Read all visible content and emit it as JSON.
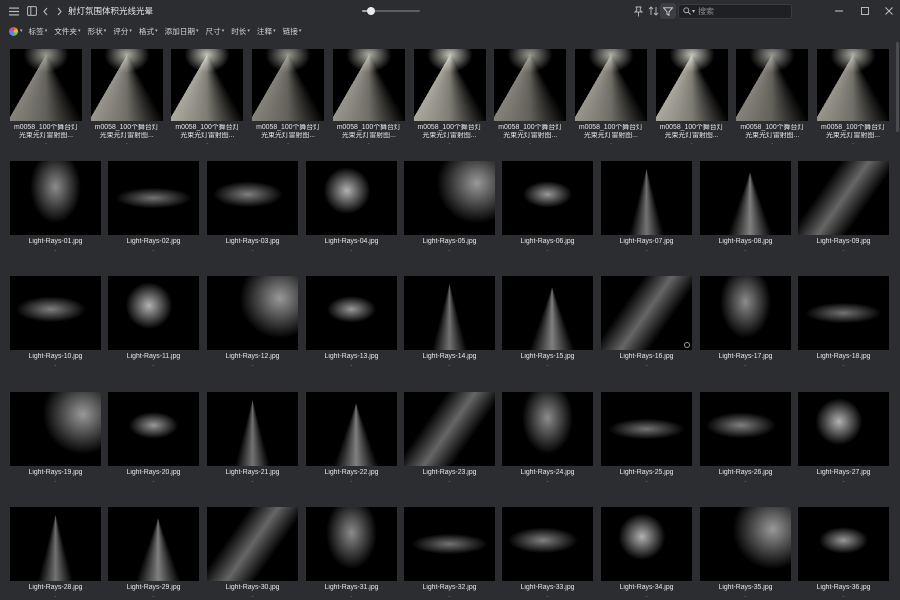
{
  "titlebar": {
    "title": "射灯氛围体积光线光晕",
    "zoom_value": 0.15,
    "search_placeholder": "搜索"
  },
  "filterbar": {
    "items": [
      "标签",
      "文件夹",
      "形状",
      "评分",
      "格式",
      "添加日期",
      "尺寸",
      "时长",
      "注释",
      "链接"
    ]
  },
  "icons": {
    "menu": "hamburger-icon",
    "sidebar": "sidebar-toggle-icon",
    "back": "chevron-left-icon",
    "forward": "chevron-right-icon",
    "pin": "pin-icon",
    "sort": "sort-icon",
    "filter": "filter-icon",
    "search": "search-icon",
    "minimize": "minimize-icon",
    "maximize": "maximize-icon",
    "close": "close-icon",
    "color": "color-wheel-icon"
  },
  "row0_files": [
    {
      "name1": "m0058_100个舞台灯",
      "name2": "光束光灯雷射图...",
      "sub": "-"
    },
    {
      "name1": "m0058_100个舞台灯",
      "name2": "光束光灯雷射图...",
      "sub": "-"
    },
    {
      "name1": "m0058_100个舞台灯",
      "name2": "光束光灯雷射图...",
      "sub": "-"
    },
    {
      "name1": "m0058_100个舞台灯",
      "name2": "光束光灯雷射图...",
      "sub": "-"
    },
    {
      "name1": "m0058_100个舞台灯",
      "name2": "光束光灯雷射图...",
      "sub": "-"
    },
    {
      "name1": "m0058_100个舞台灯",
      "name2": "光束光灯雷射图...",
      "sub": "-"
    },
    {
      "name1": "m0058_100个舞台灯",
      "name2": "光束光灯雷射图...",
      "sub": "-"
    },
    {
      "name1": "m0058_100个舞台灯",
      "name2": "光束光灯雷射图...",
      "sub": "-"
    },
    {
      "name1": "m0058_100个舞台灯",
      "name2": "光束光灯雷射图...",
      "sub": "-"
    },
    {
      "name1": "m0058_100个舞台灯",
      "name2": "光束光灯雷射图...",
      "sub": "-"
    },
    {
      "name1": "m0058_100个舞台灯",
      "name2": "光束光灯雷射图...",
      "sub": "-"
    }
  ],
  "light_rays_files": [
    {
      "name": "Light-Rays-01.jpg",
      "sub": "-"
    },
    {
      "name": "Light-Rays-02.jpg",
      "sub": "-"
    },
    {
      "name": "Light-Rays-03.jpg",
      "sub": "-"
    },
    {
      "name": "Light-Rays-04.jpg",
      "sub": "-"
    },
    {
      "name": "Light-Rays-05.jpg",
      "sub": "-"
    },
    {
      "name": "Light-Rays-06.jpg",
      "sub": "-"
    },
    {
      "name": "Light-Rays-07.jpg",
      "sub": "-"
    },
    {
      "name": "Light-Rays-08.jpg",
      "sub": "-"
    },
    {
      "name": "Light-Rays-09.jpg",
      "sub": "-"
    },
    {
      "name": "Light-Rays-10.jpg",
      "sub": "-"
    },
    {
      "name": "Light-Rays-11.jpg",
      "sub": "-"
    },
    {
      "name": "Light-Rays-12.jpg",
      "sub": "-"
    },
    {
      "name": "Light-Rays-13.jpg",
      "sub": "-"
    },
    {
      "name": "Light-Rays-14.jpg",
      "sub": "-"
    },
    {
      "name": "Light-Rays-15.jpg",
      "sub": "-"
    },
    {
      "name": "Light-Rays-16.jpg",
      "sub": "-"
    },
    {
      "name": "Light-Rays-17.jpg",
      "sub": "-"
    },
    {
      "name": "Light-Rays-18.jpg",
      "sub": "-"
    },
    {
      "name": "Light-Rays-19.jpg",
      "sub": "-"
    },
    {
      "name": "Light-Rays-20.jpg",
      "sub": "-"
    },
    {
      "name": "Light-Rays-21.jpg",
      "sub": "-"
    },
    {
      "name": "Light-Rays-22.jpg",
      "sub": "-"
    },
    {
      "name": "Light-Rays-23.jpg",
      "sub": "-"
    },
    {
      "name": "Light-Rays-24.jpg",
      "sub": "-"
    },
    {
      "name": "Light-Rays-25.jpg",
      "sub": "-"
    },
    {
      "name": "Light-Rays-26.jpg",
      "sub": "-"
    },
    {
      "name": "Light-Rays-27.jpg",
      "sub": "-"
    },
    {
      "name": "Light-Rays-28.jpg",
      "sub": "-"
    },
    {
      "name": "Light-Rays-29.jpg",
      "sub": "-"
    },
    {
      "name": "Light-Rays-30.jpg",
      "sub": "-"
    },
    {
      "name": "Light-Rays-31.jpg",
      "sub": "-"
    },
    {
      "name": "Light-Rays-32.jpg",
      "sub": "-"
    },
    {
      "name": "Light-Rays-33.jpg",
      "sub": "-"
    },
    {
      "name": "Light-Rays-34.jpg",
      "sub": "-"
    },
    {
      "name": "Light-Rays-35.jpg",
      "sub": "-"
    },
    {
      "name": "Light-Rays-36.jpg",
      "sub": "-"
    }
  ],
  "colors": {
    "background": "#2b2d30",
    "thumbnail": "#000000",
    "text": "#e6e8eb"
  }
}
